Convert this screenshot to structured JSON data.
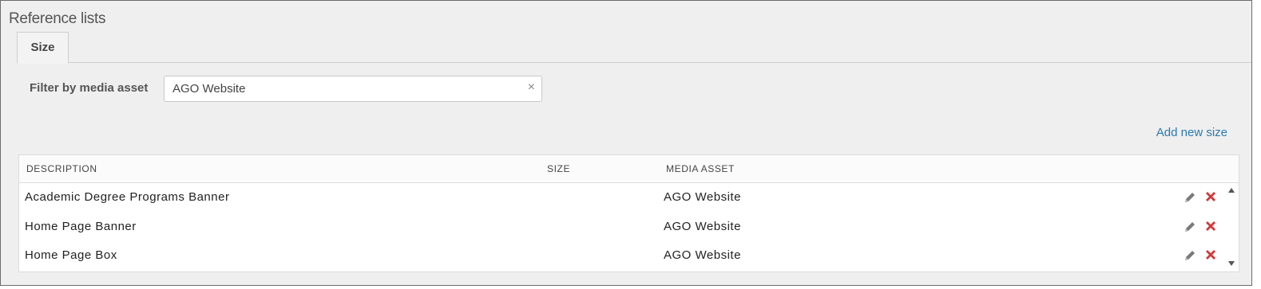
{
  "page": {
    "title": "Reference lists"
  },
  "tabs": [
    {
      "label": "Size",
      "active": true
    }
  ],
  "filter": {
    "label": "Filter by media asset",
    "value": "AGO Website",
    "clear_symbol": "×"
  },
  "actions": {
    "add_new": "Add new size"
  },
  "table": {
    "columns": [
      "DESCRIPTION",
      "SIZE",
      "MEDIA ASSET"
    ],
    "rows": [
      {
        "description": "Academic Degree Programs Banner",
        "size": "",
        "media_asset": "AGO Website"
      },
      {
        "description": "Home Page Banner",
        "size": "",
        "media_asset": "AGO Website"
      },
      {
        "description": "Home Page Box",
        "size": "",
        "media_asset": "AGO Website"
      }
    ]
  },
  "icons": {
    "edit": "pencil-icon",
    "delete": "x-icon",
    "scroll_up": "triangle-up-icon",
    "scroll_down": "triangle-down-icon"
  },
  "colors": {
    "background": "#efefef",
    "link": "#2a7ab0",
    "delete": "#d13a3a",
    "edit": "#7a7a7a"
  }
}
